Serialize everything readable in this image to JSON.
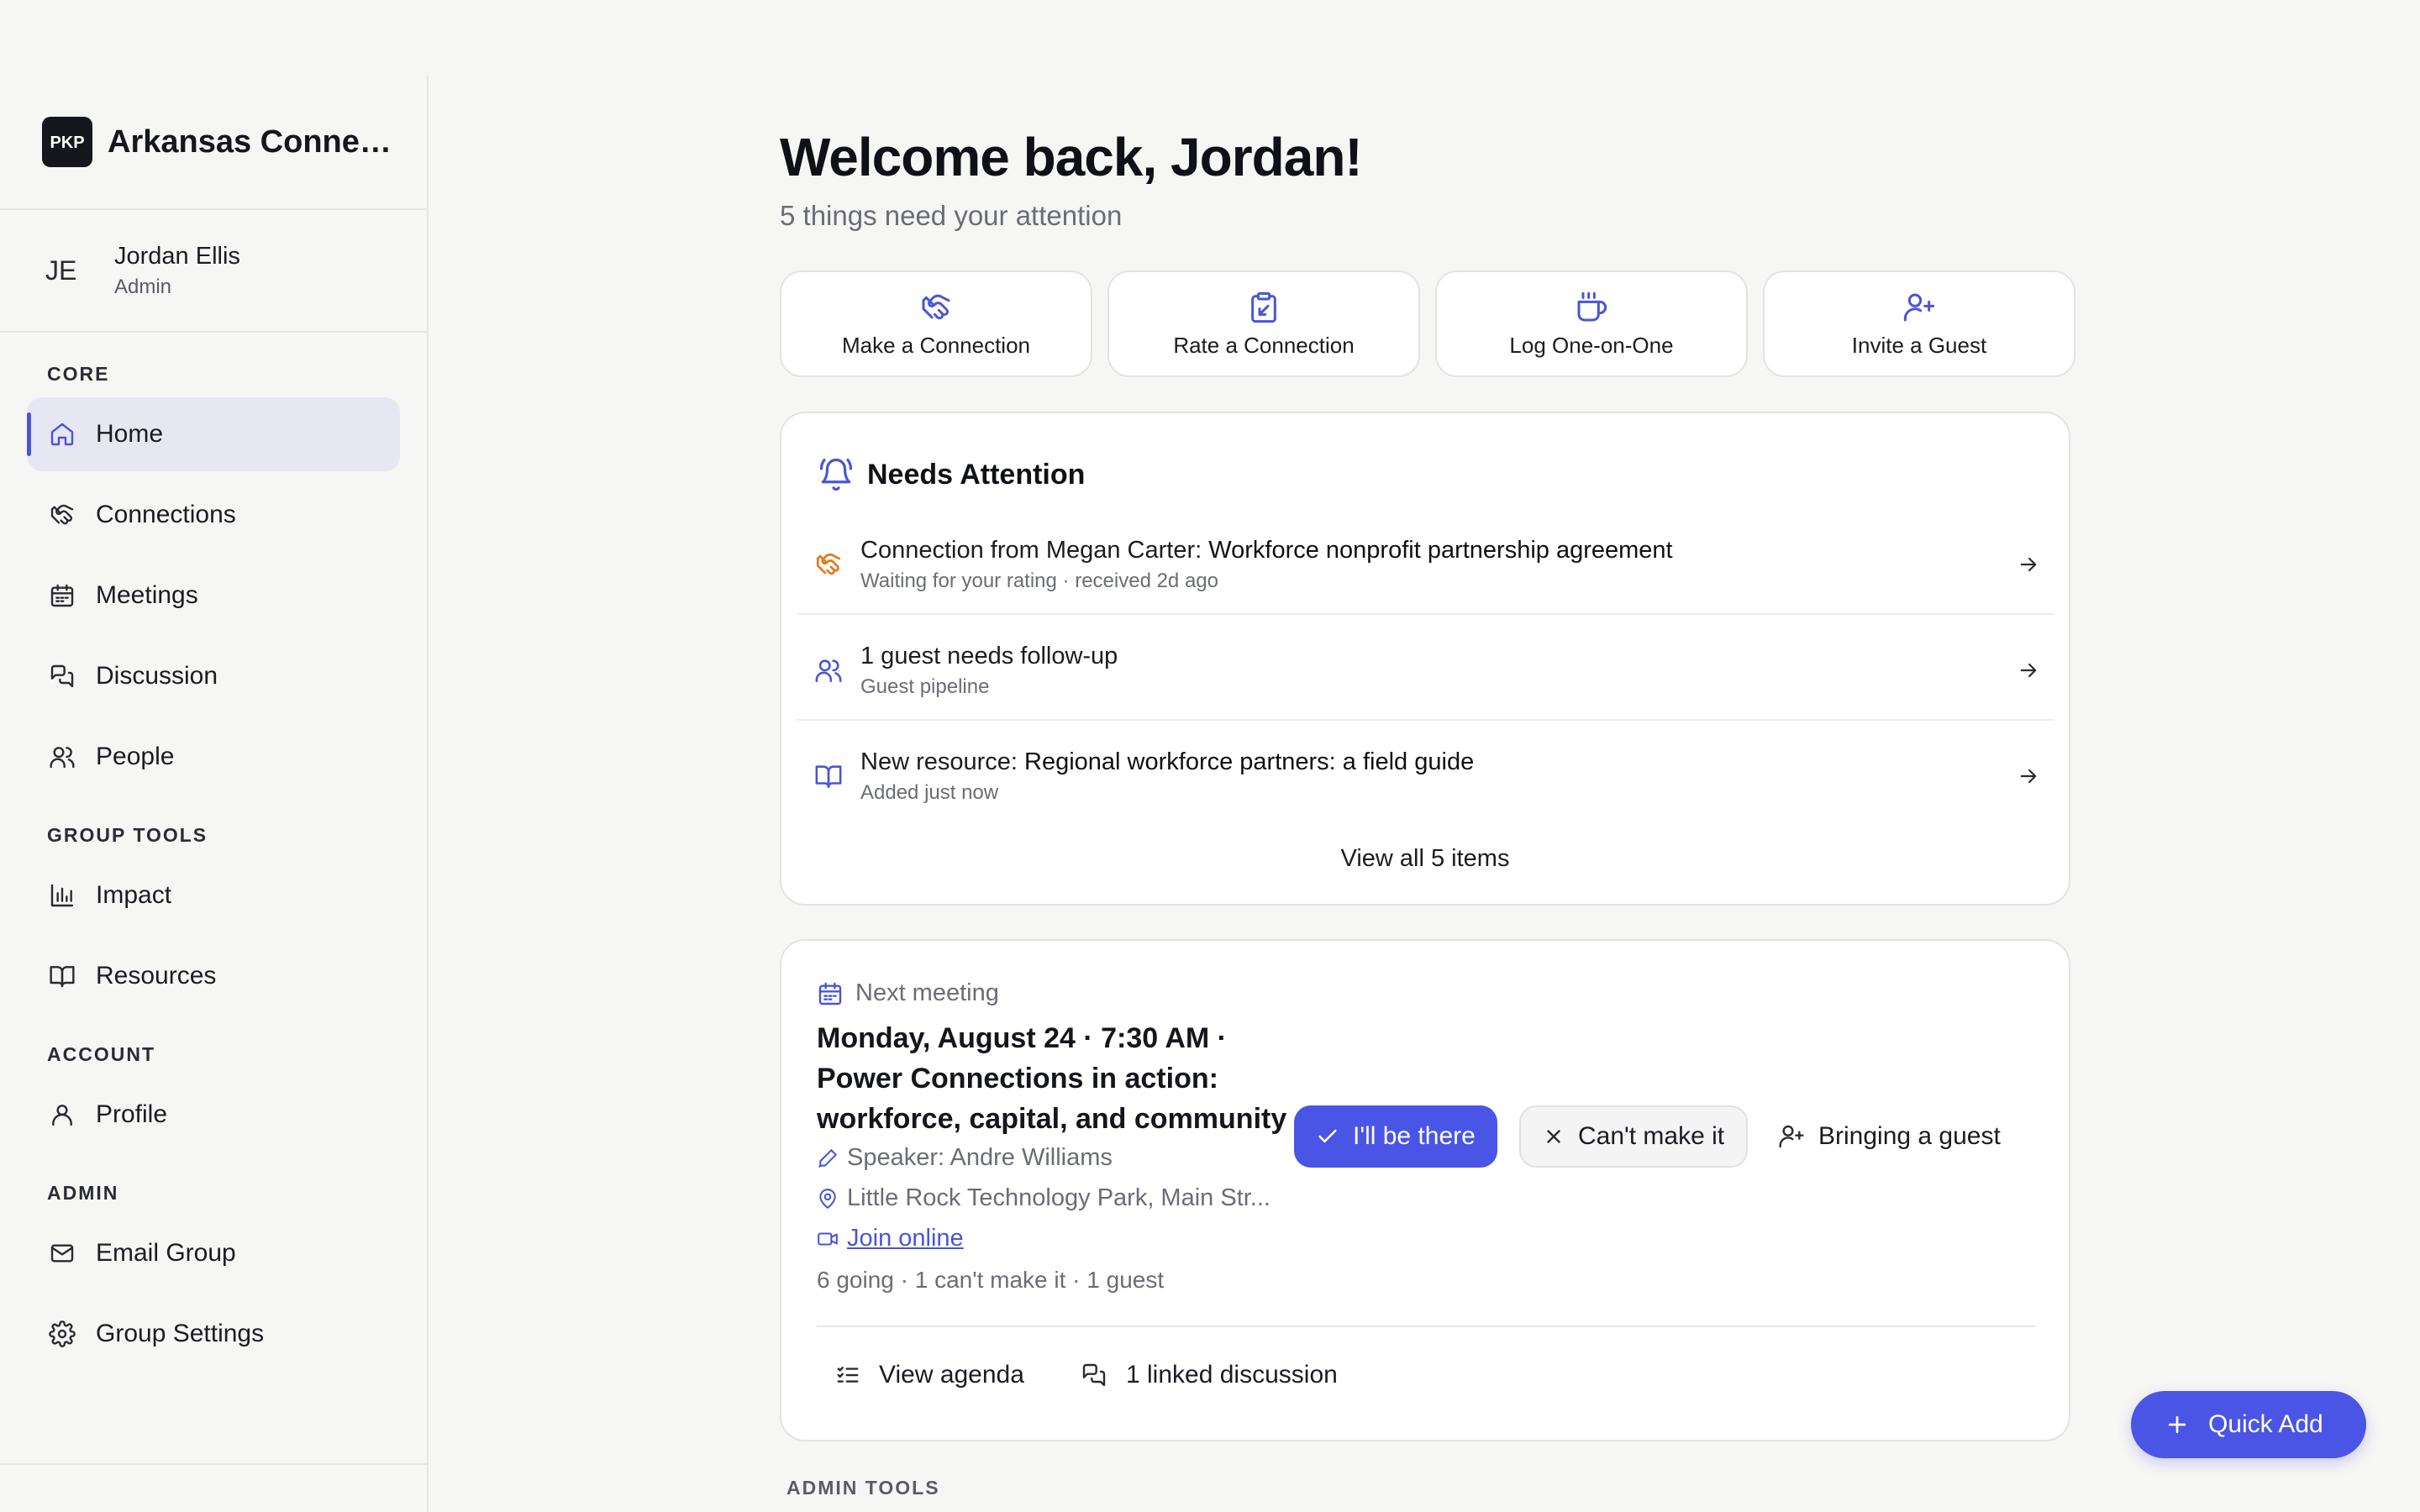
{
  "brand": {
    "name": "Arkansas Connections",
    "logo_text": "PKP"
  },
  "user": {
    "initials": "JE",
    "name": "Jordan Ellis",
    "role": "Admin"
  },
  "sidebar": {
    "sections": {
      "core": "CORE",
      "group_tools": "GROUP TOOLS",
      "account": "ACCOUNT",
      "admin": "ADMIN"
    },
    "items": {
      "home": "Home",
      "connections": "Connections",
      "meetings": "Meetings",
      "discussion": "Discussion",
      "people": "People",
      "impact": "Impact",
      "resources": "Resources",
      "profile": "Profile",
      "email_group": "Email Group",
      "group_settings": "Group Settings"
    },
    "active": "home"
  },
  "header": {
    "title": "Welcome back, Jordan!",
    "subtitle": "5 things need your attention"
  },
  "quick_actions": [
    {
      "label": "Make a Connection",
      "icon": "handshake-icon"
    },
    {
      "label": "Rate a Connection",
      "icon": "clipboard-icon"
    },
    {
      "label": "Log One-on-One",
      "icon": "coffee-icon"
    },
    {
      "label": "Invite a Guest",
      "icon": "user-plus-icon"
    }
  ],
  "needs_attention": {
    "title": "Needs Attention",
    "items": [
      {
        "prefix": "Connection from Megan Carter: ",
        "highlight": "Workforce nonprofit partnership agreement",
        "sub": "Waiting for your rating · received 2d ago",
        "icon": "handshake-icon"
      },
      {
        "prefix": "1 guest needs follow-up",
        "highlight": "",
        "sub": "Guest pipeline",
        "icon": "users-icon"
      },
      {
        "prefix": "New resource: ",
        "highlight": "Regional workforce partners: a field guide",
        "sub": "Added just now",
        "icon": "book-icon"
      }
    ],
    "view_all": "View all 5 items"
  },
  "next_meeting": {
    "label": "Next meeting",
    "title": "Monday, August 24 · 7:30 AM · Power Connections in action: workforce, capital, and community",
    "speaker": "Speaker: Andre Williams",
    "location": "Little Rock Technology Park, Main Str...",
    "join_link": "Join online",
    "counts": "6 going · 1 can't make it · 1 guest",
    "rsvp_yes": "I'll be there",
    "rsvp_no": "Can't make it",
    "rsvp_guest": "Bringing a guest",
    "view_agenda": "View agenda",
    "linked_discussion": "1 linked discussion"
  },
  "admin_tools_label": "ADMIN TOOLS",
  "fab": {
    "label": "Quick Add"
  },
  "colors": {
    "accent": "#4a55e6",
    "warning": "#e07a1f",
    "text": "#1b1c22",
    "muted": "#6b6d75"
  }
}
